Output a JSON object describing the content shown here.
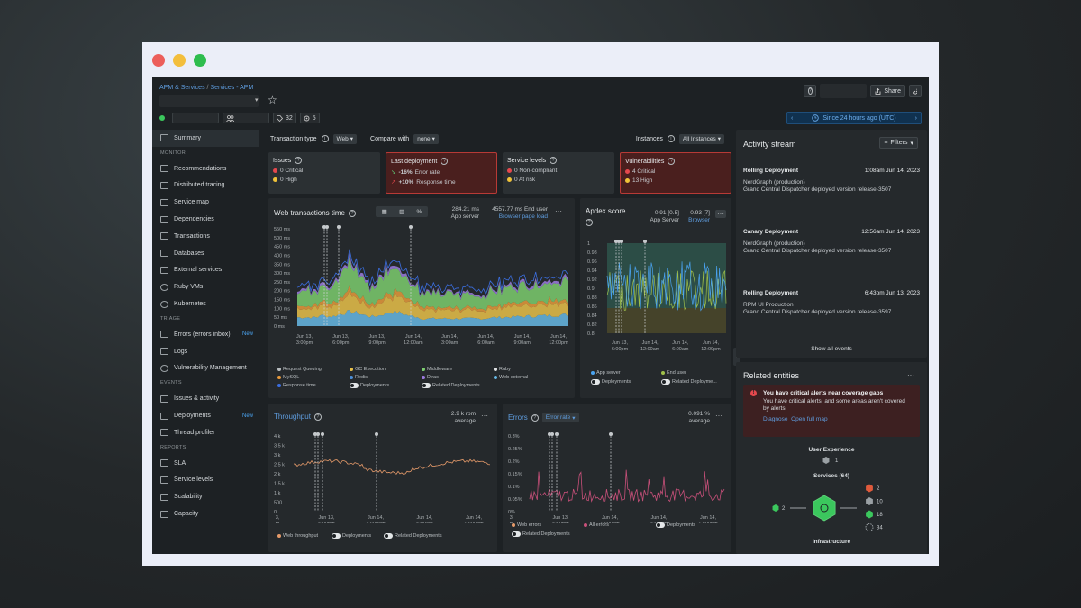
{
  "window": {
    "dots": [
      "#ec5e5a",
      "#f3be3c",
      "#2ebd4e"
    ]
  },
  "header": {
    "breadcrumb_1": "APM & Services",
    "breadcrumb_sep": "/",
    "breadcrumb_2": "Services - APM",
    "meta_count_1": "32",
    "meta_count_2": "5",
    "share_label": "Share",
    "time_range": "Since 24 hours ago (UTC)"
  },
  "sidebar": {
    "summary": "Summary",
    "section_monitor": "MONITOR",
    "monitor_items": [
      "Recommendations",
      "Distributed tracing",
      "Service map",
      "Dependencies",
      "Transactions",
      "Databases",
      "External services",
      "Ruby VMs",
      "Kubernetes"
    ],
    "section_triage": "TRIAGE",
    "triage_items": [
      "Errors (errors inbox)",
      "Logs",
      "Vulnerability Management"
    ],
    "section_events": "EVENTS",
    "events_items": [
      "Issues & activity",
      "Deployments",
      "Thread profiler"
    ],
    "section_reports": "REPORTS",
    "reports_items": [
      "SLA",
      "Service levels",
      "Scalability",
      "Capacity"
    ],
    "new_badge": "New"
  },
  "filters": {
    "transaction_type_label": "Transaction type",
    "transaction_type_value": "Web",
    "compare_label": "Compare with",
    "compare_value": "none",
    "instances_label": "Instances",
    "instances_value": "All Instances"
  },
  "stats": {
    "issues": {
      "title": "Issues",
      "line1": "0 Critical",
      "line2": "0 High"
    },
    "deployment": {
      "title": "Last deployment",
      "line1_val": "-16%",
      "line1_text": "Error rate",
      "line2_val": "+10%",
      "line2_text": "Response time"
    },
    "service_levels": {
      "title": "Service levels",
      "line1": "0 Non-compliant",
      "line2": "0 At risk"
    },
    "vulnerabilities": {
      "title": "Vulnerabilities",
      "line1": "4 Critical",
      "line2": "13 High"
    }
  },
  "web_transactions": {
    "title": "Web transactions time",
    "app_value": "284.21 ms",
    "app_label": "App server",
    "end_value": "4557.77 ms",
    "end_label": "End user",
    "browser_link": "Browser page load",
    "y_ticks": [
      "550 ms",
      "500 ms",
      "450 ms",
      "400 ms",
      "350 ms",
      "300 ms",
      "250 ms",
      "200 ms",
      "150 ms",
      "100 ms",
      "50 ms",
      "0 ms"
    ],
    "x_ticks": [
      [
        "Jun 13,",
        "3:00pm"
      ],
      [
        "Jun 13,",
        "6:00pm"
      ],
      [
        "Jun 13,",
        "9:00pm"
      ],
      [
        "Jun 14,",
        "12:00am"
      ],
      [
        "Jun 14,",
        "3:00am"
      ],
      [
        "Jun 14,",
        "6:00am"
      ],
      [
        "Jun 14,",
        "9:00am"
      ],
      [
        "Jun 14,",
        "12:00pm"
      ]
    ],
    "legend": [
      "Request Queuing",
      "GC Execution",
      "Middleware",
      "Ruby",
      "MySQL",
      "Redis",
      "Dirac",
      "Web external",
      "Response time",
      "Deployments",
      "Related Deployments"
    ],
    "legend_colors": [
      "#b9bec1",
      "#e9c14a",
      "#7ccd6f",
      "#e0e3e5",
      "#e89a3c",
      "#4c8fd8",
      "#9c7be0",
      "#67b8e5",
      "#3b6ee0"
    ]
  },
  "apdex": {
    "title": "Apdex score",
    "app_value": "0.91",
    "app_t": "[0.5]",
    "app_label": "App Server",
    "browser_value": "0.93",
    "browser_t": "[7]",
    "browser_label": "Browser",
    "y_ticks": [
      "1",
      "0.98",
      "0.96",
      "0.94",
      "0.92",
      "0.9",
      "0.88",
      "0.86",
      "0.84",
      "0.82",
      "0.8"
    ],
    "x_ticks": [
      [
        "Jun 13,",
        "6:00pm"
      ],
      [
        "Jun 14,",
        "12:00am"
      ],
      [
        "Jun 14,",
        "6:00am"
      ],
      [
        "Jun 14,",
        "12:00pm"
      ]
    ],
    "legend": [
      "App server",
      "End user",
      "Deployments",
      "Related Deployme..."
    ]
  },
  "throughput": {
    "title": "Throughput",
    "value": "2.9 k",
    "unit": "rpm",
    "label": "average",
    "y_ticks": [
      "4 k",
      "3.5 k",
      "3 k",
      "2.5 k",
      "2 k",
      "1.5 k",
      "1 k",
      "500",
      "0"
    ],
    "x_ticks": [
      [
        "3,",
        "m"
      ],
      [
        "Jun 13,",
        "6:00pm"
      ],
      [
        "Jun 14,",
        "12:00am"
      ],
      [
        "Jun 14,",
        "6:00am"
      ],
      [
        "Jun 14,",
        "12:00pm"
      ]
    ],
    "legend": [
      "Web throughput",
      "Deployments",
      "Related Deployments"
    ]
  },
  "errors": {
    "title": "Errors",
    "dropdown": "Error rate",
    "value": "0.091",
    "unit": "%",
    "label": "average",
    "y_ticks": [
      "0.3%",
      "0.25%",
      "0.2%",
      "0.15%",
      "0.1%",
      "0.05%",
      "0%"
    ],
    "x_ticks": [
      [
        "3,",
        "m"
      ],
      [
        "Jun 13,",
        "6:00pm"
      ],
      [
        "Jun 14,",
        "12:00am"
      ],
      [
        "Jun 14,",
        "6:00am"
      ],
      [
        "Jun 14,",
        "12:00pm"
      ]
    ],
    "legend": [
      "Web errors",
      "All errors",
      "Deployments",
      "Related Deployments"
    ]
  },
  "activity": {
    "title": "Activity stream",
    "filters": "Filters",
    "items": [
      {
        "type": "Rolling Deployment",
        "time": "1:08am Jun 14, 2023",
        "source": "NerdGraph (production)",
        "desc": "Grand Central Dispatcher deployed version release-3507"
      },
      {
        "type": "Canary Deployment",
        "time": "12:56am Jun 14, 2023",
        "source": "NerdGraph (production)",
        "desc": "Grand Central Dispatcher deployed version release-3507"
      },
      {
        "type": "Rolling Deployment",
        "time": "6:43pm Jun 13, 2023",
        "source": "RPM UI Production",
        "desc": "Grand Central Dispatcher deployed version release-3597"
      }
    ],
    "show_all": "Show all events"
  },
  "related": {
    "title": "Related entities",
    "alert_title": "You have critical alerts near coverage gaps",
    "alert_text": "You have critical alerts, and some areas aren't covered by alerts.",
    "link_diagnose": "Diagnose",
    "link_map": "Open full map",
    "user_exp": "User Experience",
    "user_count": "1",
    "services": "Services (64)",
    "left_count": "2",
    "counts": [
      "2",
      "10",
      "18",
      "34"
    ],
    "infrastructure": "Infrastructure"
  }
}
